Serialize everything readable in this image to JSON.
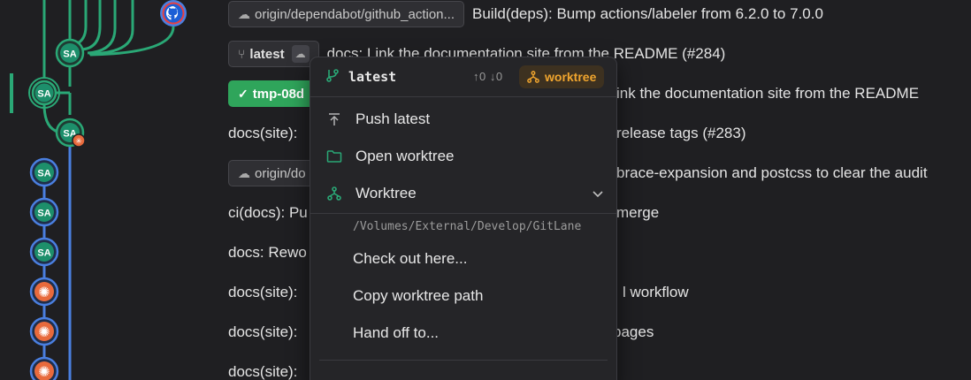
{
  "graph": {
    "avatars": [
      {
        "label": "SA"
      },
      {
        "label": "SA"
      },
      {
        "label": "SA"
      },
      {
        "label": "SA"
      },
      {
        "label": "SA"
      },
      {
        "label": "SA"
      }
    ]
  },
  "rows": [
    {
      "pill": "origin/dependabot/github_action...",
      "text": "Build(deps): Bump actions/labeler from 6.2.0 to 7.0.0"
    },
    {
      "pill": "latest",
      "text": "docs: Link the documentation site from the README (#284)"
    },
    {
      "pill": "tmp-08d",
      "text": "ink the documentation site from the README"
    },
    {
      "prefix": "docs(site):",
      "text": "release tags (#283)"
    },
    {
      "pill": "origin/do",
      "text": "brace-expansion and postcss to clear the audit"
    },
    {
      "prefix": "ci(docs): Pu",
      "text": "merge"
    },
    {
      "prefix": "docs: Rewo",
      "text": ""
    },
    {
      "prefix": "docs(site):",
      "text": "l workflow"
    },
    {
      "prefix": "docs(site):",
      "text": "pages"
    },
    {
      "prefix": "docs(site):",
      "text": ""
    }
  ],
  "menu": {
    "branch": "latest",
    "ahead": "↑0",
    "behind": "↓0",
    "badge": "worktree",
    "items": [
      {
        "label": "Push latest",
        "icon": "push-icon"
      },
      {
        "label": "Open worktree",
        "icon": "folder-icon"
      },
      {
        "label": "Worktree",
        "icon": "worktree-icon"
      }
    ],
    "path": "/Volumes/External/Develop/GitLane",
    "subitems": [
      "Check out here...",
      "Copy worktree path",
      "Hand off to..."
    ]
  },
  "colors": {
    "graph_green": "#2aa876",
    "graph_blue": "#4a7fe0",
    "accent_orange": "#f0a52e",
    "pill_green": "#2fa55b"
  }
}
